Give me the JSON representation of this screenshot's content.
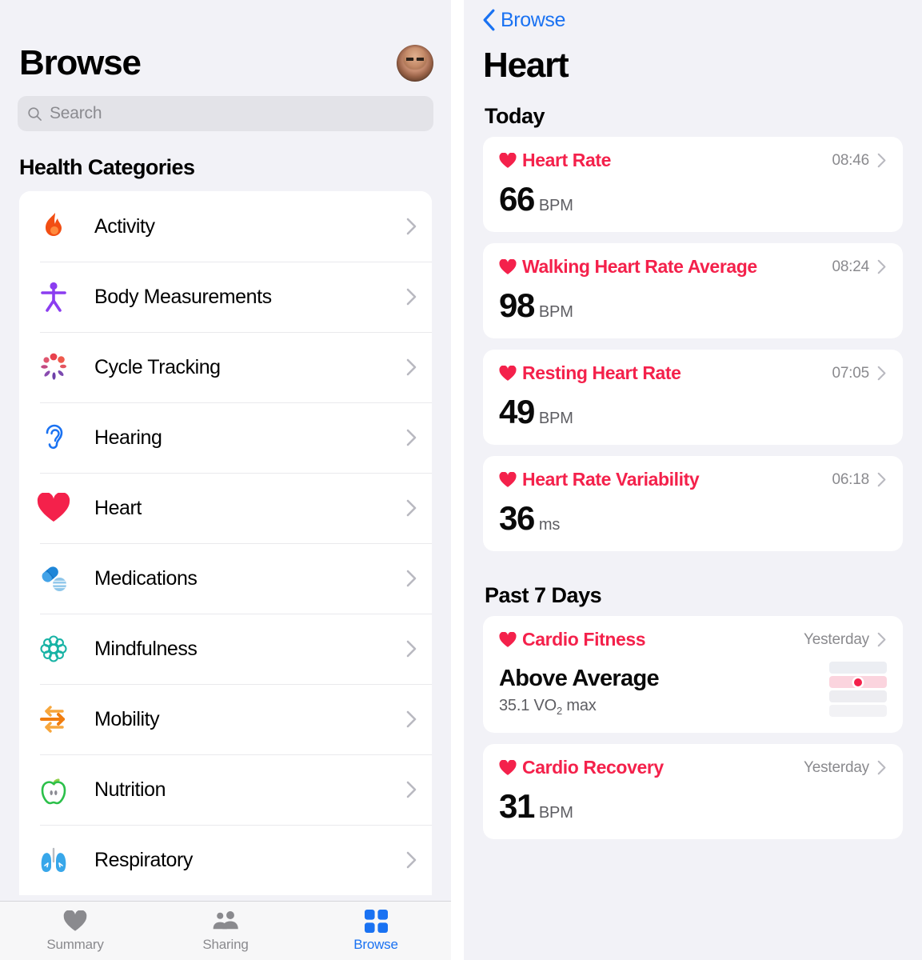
{
  "colors": {
    "accent_red": "#f4214b",
    "accent_blue": "#1a72f2",
    "background": "#f2f2f7",
    "card": "#ffffff",
    "secondary_text": "#8a8a8e"
  },
  "left_pane": {
    "title": "Browse",
    "avatar_name": "profile-avatar",
    "search": {
      "placeholder": "Search",
      "value": ""
    },
    "section_title": "Health Categories",
    "categories": [
      {
        "label": "Activity",
        "icon": "flame-icon"
      },
      {
        "label": "Body Measurements",
        "icon": "body-figure-icon"
      },
      {
        "label": "Cycle Tracking",
        "icon": "cycle-petals-icon"
      },
      {
        "label": "Hearing",
        "icon": "ear-icon"
      },
      {
        "label": "Heart",
        "icon": "heart-icon"
      },
      {
        "label": "Medications",
        "icon": "pills-icon"
      },
      {
        "label": "Mindfulness",
        "icon": "brain-icon"
      },
      {
        "label": "Mobility",
        "icon": "arrows-icon"
      },
      {
        "label": "Nutrition",
        "icon": "apple-icon"
      },
      {
        "label": "Respiratory",
        "icon": "lungs-icon"
      }
    ],
    "tabs": [
      {
        "label": "Summary",
        "icon": "heart-icon",
        "active": false
      },
      {
        "label": "Sharing",
        "icon": "people-icon",
        "active": false
      },
      {
        "label": "Browse",
        "icon": "grid-icon",
        "active": true
      }
    ]
  },
  "right_pane": {
    "back_label": "Browse",
    "title": "Heart",
    "sections": [
      {
        "title": "Today",
        "cards": [
          {
            "name": "Heart Rate",
            "time": "08:46",
            "value": "66",
            "unit": "BPM"
          },
          {
            "name": "Walking Heart Rate Average",
            "time": "08:24",
            "value": "98",
            "unit": "BPM"
          },
          {
            "name": "Resting Heart Rate",
            "time": "07:05",
            "value": "49",
            "unit": "BPM"
          },
          {
            "name": "Heart Rate Variability",
            "time": "06:18",
            "value": "36",
            "unit": "ms"
          }
        ]
      },
      {
        "title": "Past 7 Days",
        "cards": [
          {
            "name": "Cardio Fitness",
            "time": "Yesterday",
            "headline": "Above Average",
            "subline_value": "35.1 VO",
            "subline_sub": "2",
            "subline_tail": " max",
            "range_widget": {
              "bands": 4,
              "highlighted_band": 2,
              "marker_position": "center"
            }
          },
          {
            "name": "Cardio Recovery",
            "time": "Yesterday",
            "value": "31",
            "unit": "BPM"
          }
        ]
      }
    ]
  }
}
